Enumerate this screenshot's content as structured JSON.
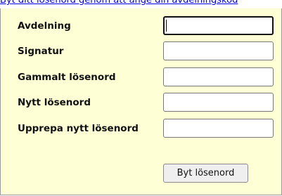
{
  "header": {
    "text": "Byt ditt lösenord genom att ange din avdelningskod"
  },
  "form": {
    "fields": [
      {
        "label": "Avdelning",
        "value": ""
      },
      {
        "label": "Signatur",
        "value": ""
      },
      {
        "label": "Gammalt lösenord",
        "value": ""
      },
      {
        "label": "Nytt lösenord",
        "value": ""
      },
      {
        "label": "Upprepa nytt lösenord",
        "value": ""
      }
    ],
    "submit_label": "Byt lösenord"
  },
  "colors": {
    "panel_background": "#ffffd6",
    "link": "#0000ee"
  }
}
